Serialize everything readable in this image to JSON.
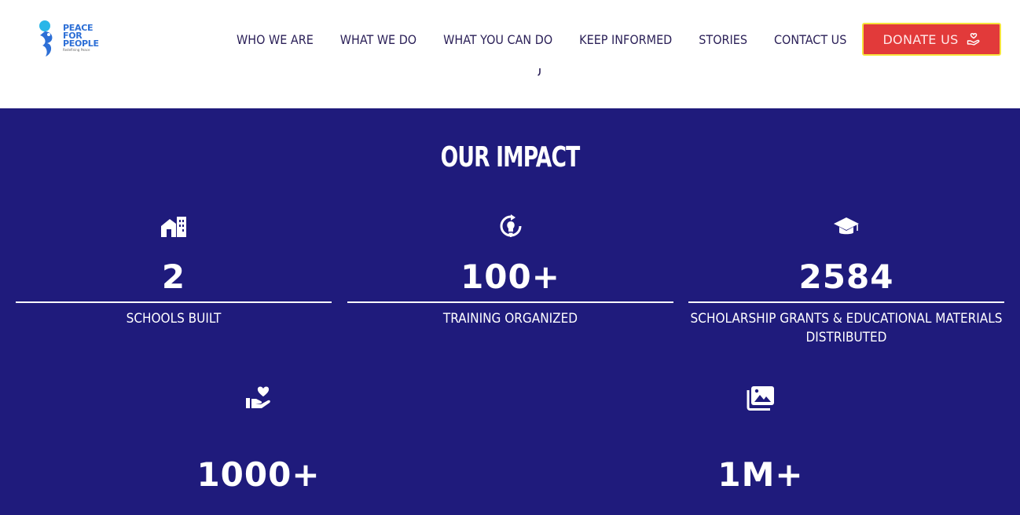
{
  "header": {
    "logo": {
      "line1": "PEACE",
      "line2": "FOR",
      "line3": "PEOPLE",
      "tagline": "Redefining Peace",
      "icon": "dove-people-icon"
    },
    "nav": [
      {
        "label": "WHO WE ARE"
      },
      {
        "label": "WHAT WE DO"
      },
      {
        "label": "WHAT YOU CAN DO"
      },
      {
        "label": "KEEP INFORMED"
      },
      {
        "label": "STORIES"
      },
      {
        "label": "CONTACT US"
      }
    ],
    "donate": {
      "label": "DONATE US",
      "icon": "hand-heart-icon"
    }
  },
  "impact": {
    "title": "OUR IMPACT",
    "stats": [
      {
        "icon": "school-building-icon",
        "value": "2",
        "label": "SCHOOLS BUILT"
      },
      {
        "icon": "lightbulb-refresh-icon",
        "value": "100+",
        "label": "TRAINING ORGANIZED"
      },
      {
        "icon": "graduation-cap-icon",
        "value": "2584",
        "label": "SCHOLARSHIP GRANTS & EDUCATIONAL MATERIALS DISTRIBUTED"
      },
      {
        "icon": "hand-holding-heart-icon",
        "value": "1000+",
        "label": ""
      },
      {
        "icon": "photo-gallery-icon",
        "value": "1M+",
        "label": ""
      }
    ]
  },
  "colors": {
    "brand_blue": "#2d6fd6",
    "nav_text": "#2a1f57",
    "impact_bg": "#1f1b7c",
    "donate_bg": "#e23a3a",
    "donate_border": "#f6e33c"
  }
}
